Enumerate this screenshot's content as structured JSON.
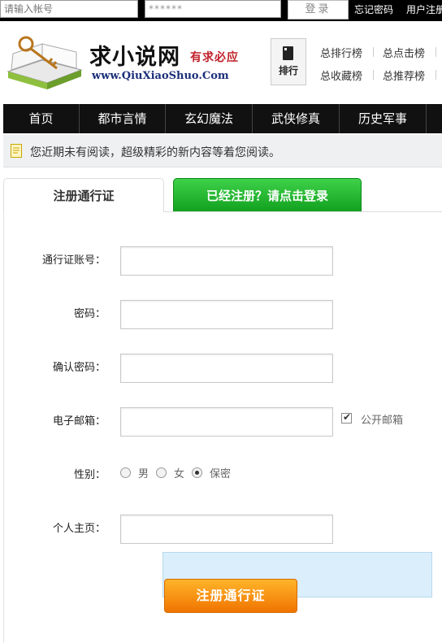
{
  "topbar": {
    "username_placeholder": "请输入帐号",
    "password_value": "******",
    "login_label": "登录",
    "forgot_label": "忘记密码",
    "register_label": "用户注册"
  },
  "header": {
    "site_name": "求小说网",
    "slogan": "有求必应",
    "site_url": "www.QiuXiaoShuo.Com",
    "rank_label": "排行",
    "rank_links": [
      "总排行榜",
      "总点击榜",
      "总收藏榜",
      "总推荐榜"
    ]
  },
  "nav": {
    "items": [
      "首页",
      "都市言情",
      "玄幻魔法",
      "武侠修真",
      "历史军事"
    ]
  },
  "notice": {
    "text": "您近期未有阅读，超级精彩的新内容等着您阅读。"
  },
  "tabs": {
    "register": "注册通行证",
    "login": "已经注册？请点击登录"
  },
  "form": {
    "account_label": "通行证账号：",
    "password_label": "密码：",
    "confirm_label": "确认密码：",
    "email_label": "电子邮箱：",
    "public_email_label": "公开邮箱",
    "public_email_checked": true,
    "gender_label": "性别：",
    "gender_options": [
      "男",
      "女",
      "保密"
    ],
    "gender_selected": "保密",
    "homepage_label": "个人主页：",
    "submit_label": "注册通行证"
  },
  "colors": {
    "nav_bg": "#111111",
    "login_tab": "#12a11f",
    "submit": "#f07400",
    "slogan": "#c0202a",
    "url": "#1a2f7a"
  }
}
